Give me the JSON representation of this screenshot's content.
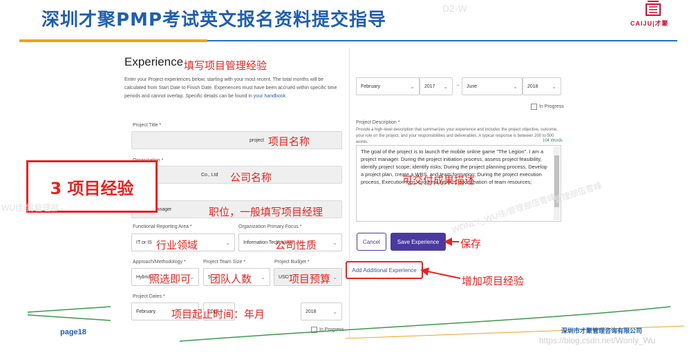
{
  "slide": {
    "title": "深圳才聚PMP考试英文报名资料提交指导",
    "logo_text": "CAIJU|才聚",
    "page": "page18",
    "company": "深圳市才聚管理咨询有限公司",
    "url_watermark": "https://blog.csdn.net/Wonly_Wu",
    "watermark_top": "D2-W",
    "watermark_left": "WU佳/需管理部",
    "watermark_mid": "WONLY_WU佳/管理部伍雪峰",
    "watermark_right": "管理部伍雪峰",
    "colors": {
      "title_blue": "#1f5fb0",
      "accent_orange": "#f0a21b",
      "annotation_red": "#e8231f",
      "button_purple": "#4a3aa0"
    }
  },
  "callout": {
    "text": "3 项目经验"
  },
  "form": {
    "section_title": "Experience",
    "intro_text": "Enter your Project experiences below, starting with your most recent. The total months will be calculated from Start Date to Finish Date. Experiences must have been accrued within specific time periods and cannot overlap. Specific details can be found in",
    "intro_link": "your handbook",
    "project_title": {
      "label": "Project Title *",
      "value": "project"
    },
    "organization": {
      "label": "Organization *",
      "value": "Co., Ltd"
    },
    "job_title": {
      "label": "Job Title *",
      "value": "Project Manager"
    },
    "functional_area": {
      "label": "Functional Reporting Area *",
      "value": "IT or IS"
    },
    "org_focus": {
      "label": "Organization Primary Focus *",
      "value": "Information Technology"
    },
    "approach": {
      "label": "Approach/Methodology *",
      "value": "Hybrid"
    },
    "team_size": {
      "label": "Project Team Size *",
      "value": "5"
    },
    "budget": {
      "label": "Project Budget *",
      "value": "USD"
    },
    "dates": {
      "label": "Project Dates *",
      "start_month": "February",
      "start_year": "2017",
      "end_year": "2018",
      "in_progress": "In Progress"
    },
    "right_dates": {
      "start_month": "February",
      "start_year": "2017",
      "dash": "-",
      "end_month": "June",
      "end_year": "2018",
      "in_progress": "In Progress"
    },
    "description": {
      "label": "Project Description *",
      "help": "Provide a high-level description that summarizes your experience and includes the project objective, outcome, your role on the project, and your responsibilities and deliverables. A typical response is between 200 to 500 words.",
      "word_count": "104 Words",
      "text": "The goal of the project is to launch the mobile online game \"The Legion\". I am a project manager. During the project initiation process, assess project feasibility, identify project scope; identify risks; During the project planning process, Develop a project plan, create a WBS, and team formation; During the project execution process, Execution logs, progress reports, coordination of team resources;"
    },
    "cancel_label": "Cancel",
    "save_label": "Save Experience",
    "add_label": "Add Additional Experience"
  },
  "annotations": {
    "experience": "填写项目管理经验",
    "project_name": "项目名称",
    "company_name": "公司名称",
    "job": "职位，一般填写项目经理",
    "industry": "行业领域",
    "company_nature": "公司性质",
    "optional": "照选即可",
    "team": "团队人数",
    "budget": "项目预算",
    "dates": "项目起止时间：年月",
    "deliverables": "可交付成果描述",
    "save": "保存",
    "add": "增加项目经验"
  }
}
